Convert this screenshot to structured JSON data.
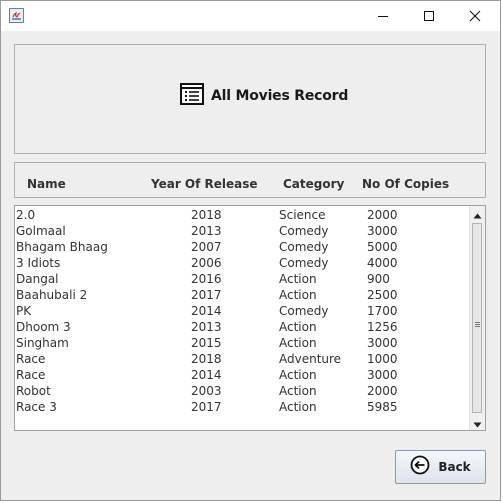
{
  "window": {
    "minimize_icon": "minimize-icon",
    "maximize_icon": "maximize-icon",
    "close_icon": "close-icon"
  },
  "header": {
    "title": "All Movies Record",
    "icon": "list-document-icon"
  },
  "columns": {
    "name": "Name",
    "year": "Year Of Release",
    "category": "Category",
    "copies": "No Of Copies"
  },
  "records": [
    {
      "name": "2.0",
      "year": "2018",
      "category": "Science",
      "copies": "2000"
    },
    {
      "name": "Golmaal",
      "year": "2013",
      "category": "Comedy",
      "copies": "3000"
    },
    {
      "name": "Bhagam Bhaag",
      "year": "2007",
      "category": "Comedy",
      "copies": "5000"
    },
    {
      "name": "3 Idiots",
      "year": "2006",
      "category": "Comedy",
      "copies": "4000"
    },
    {
      "name": "Dangal",
      "year": "2016",
      "category": "Action",
      "copies": "900"
    },
    {
      "name": "Baahubali 2",
      "year": "2017",
      "category": "Action",
      "copies": "2500"
    },
    {
      "name": "PK",
      "year": "2014",
      "category": "Comedy",
      "copies": "1700"
    },
    {
      "name": "Dhoom 3",
      "year": "2013",
      "category": "Action",
      "copies": "1256"
    },
    {
      "name": "Singham",
      "year": "2015",
      "category": "Action",
      "copies": "3000"
    },
    {
      "name": "Race",
      "year": "2018",
      "category": "Adventure",
      "copies": "1000"
    },
    {
      "name": "Race",
      "year": "2014",
      "category": "Action",
      "copies": "3000"
    },
    {
      "name": "Robot",
      "year": "2003",
      "category": "Action",
      "copies": "2000"
    },
    {
      "name": "Race 3",
      "year": "2017",
      "category": "Action",
      "copies": "5985"
    }
  ],
  "back_button": {
    "label": "Back",
    "icon": "back-arrow-circle-icon"
  },
  "colors": {
    "window_bg": "#eeeeee",
    "list_bg": "#ffffff",
    "text": "#333333",
    "button_border": "#8a9aad"
  }
}
